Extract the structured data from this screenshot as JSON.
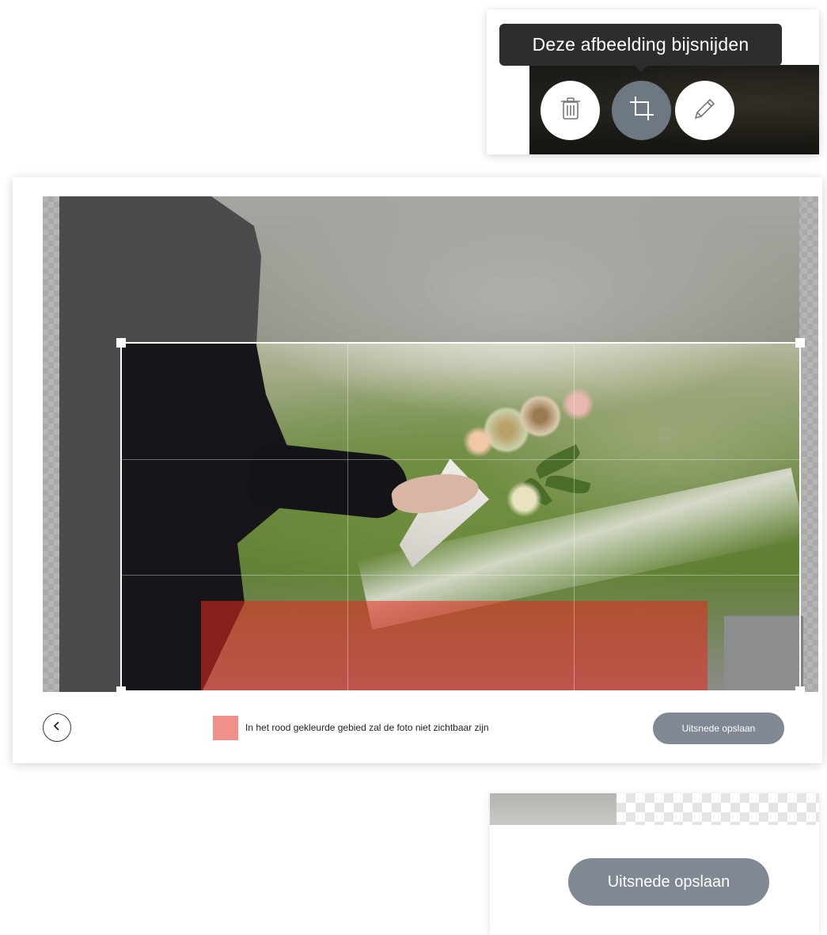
{
  "toolbar": {
    "tooltip_label": "Deze afbeelding bijsnijden",
    "buttons": [
      {
        "icon": "trash-icon"
      },
      {
        "icon": "crop-icon",
        "active": true
      },
      {
        "icon": "pencil-icon"
      }
    ]
  },
  "editor": {
    "legend_text": "In het rood gekleurde gebied zal de foto niet zichtbaar zijn",
    "save_label": "Uitsnede opslaan",
    "back_icon": "chevron-left-icon",
    "colors": {
      "red_zone": "#e8281e",
      "legend_swatch": "#f0908b",
      "button": "#7f8893"
    }
  },
  "save_zoom": {
    "save_label": "Uitsnede opslaan"
  }
}
